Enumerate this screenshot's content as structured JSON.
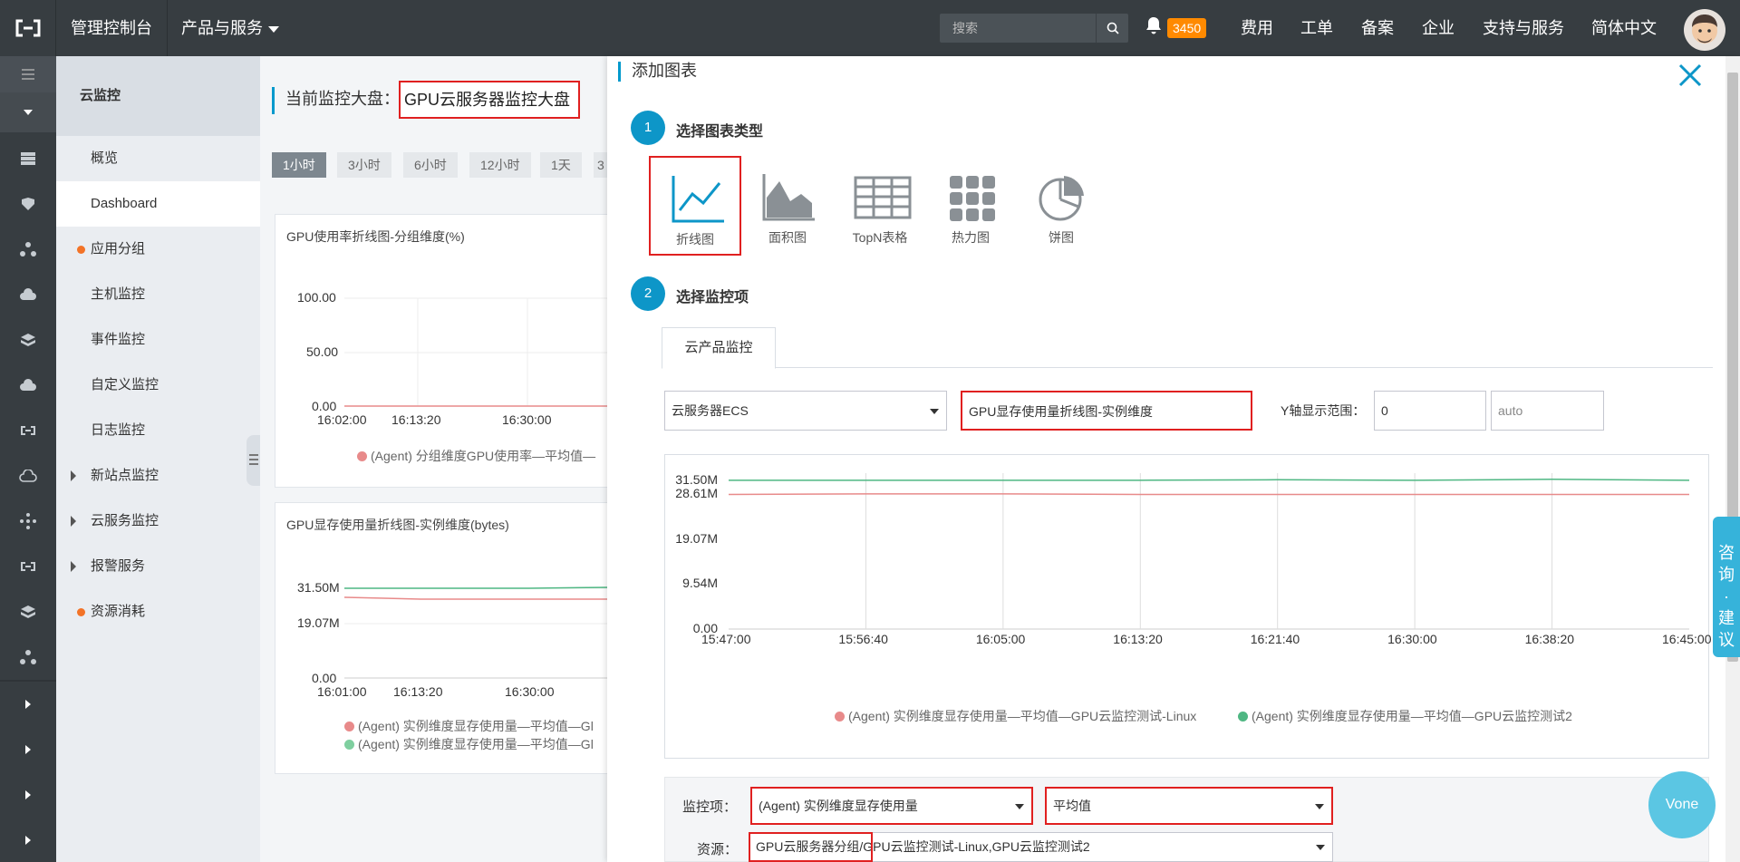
{
  "topbar": {
    "brand": "管理控制台",
    "products": "产品与服务",
    "search_placeholder": "搜索",
    "notification_count": "3450",
    "nav": [
      "费用",
      "工单",
      "备案",
      "企业",
      "支持与服务",
      "简体中文"
    ]
  },
  "sidebar": {
    "title": "云监控",
    "items": [
      {
        "label": "概览"
      },
      {
        "label": "Dashboard"
      },
      {
        "label": "应用分组"
      },
      {
        "label": "主机监控"
      },
      {
        "label": "事件监控"
      },
      {
        "label": "自定义监控"
      },
      {
        "label": "日志监控"
      },
      {
        "label": "新站点监控"
      },
      {
        "label": "云服务监控"
      },
      {
        "label": "报警服务"
      },
      {
        "label": "资源消耗"
      }
    ]
  },
  "main": {
    "current_label": "当前监控大盘：",
    "dashboard_name": "GPU云服务器监控大盘",
    "time_buttons": [
      "1小时",
      "3小时",
      "6小时",
      "12小时",
      "1天",
      "3"
    ],
    "card1": {
      "title": "GPU使用率折线图-分组维度(%)",
      "y_ticks": [
        "100.00",
        "50.00",
        "0.00"
      ],
      "x_ticks": [
        "16:02:00",
        "16:13:20",
        "16:30:00"
      ],
      "legend": "(Agent) 分组维度GPU使用率—平均值—"
    },
    "card2": {
      "title": "GPU显存使用量折线图-实例维度(bytes)",
      "y_ticks": [
        "31.50M",
        "19.07M",
        "0.00"
      ],
      "x_ticks": [
        "16:01:00",
        "16:13:20",
        "16:30:00"
      ],
      "legend": [
        "(Agent) 实例维度显存使用量—平均值—Gl",
        "(Agent) 实例维度显存使用量—平均值—Gl"
      ]
    }
  },
  "panel": {
    "title": "添加图表",
    "step1": {
      "num": "1",
      "label": "选择图表类型"
    },
    "chart_types": [
      {
        "label": "折线图",
        "icon": "line-chart-icon",
        "selected": true
      },
      {
        "label": "面积图",
        "icon": "area-chart-icon"
      },
      {
        "label": "TopN表格",
        "icon": "table-icon"
      },
      {
        "label": "热力图",
        "icon": "heatmap-icon"
      },
      {
        "label": "饼图",
        "icon": "pie-chart-icon"
      }
    ],
    "step2": {
      "num": "2",
      "label": "选择监控项"
    },
    "tab": "云产品监控",
    "product_select": "云服务器ECS",
    "chart_name": "GPU显存使用量折线图-实例维度",
    "y_range_label": "Y轴显示范围：",
    "y_min": "0",
    "y_max_placeholder": "auto",
    "metric_label": "监控项：",
    "metric_value": "(Agent) 实例维度显存使用量",
    "stat_value": "平均值",
    "resource_label": "资源：",
    "resource_value": "GPU云服务器分组/GPU云监控测试-Linux,GPU云监控测试2"
  },
  "chart_data": {
    "type": "line",
    "x": [
      "15:47:00",
      "15:56:40",
      "16:05:00",
      "16:13:20",
      "16:21:40",
      "16:30:00",
      "16:38:20",
      "16:45:00"
    ],
    "y_ticks": [
      "31.50M",
      "28.61M",
      "19.07M",
      "9.54M",
      "0.00"
    ],
    "ylim": [
      0,
      33
    ],
    "series": [
      {
        "name": "(Agent) 实例维度显存使用量—平均值—GPU云监控测试-Linux",
        "color": "#e88a8a",
        "values": [
          28.5,
          28.6,
          28.6,
          28.5,
          28.5,
          28.5,
          28.5,
          28.5
        ]
      },
      {
        "name": "(Agent) 实例维度显存使用量—平均值—GPU云监控测试2",
        "color": "#4fb783",
        "values": [
          31.5,
          31.5,
          31.5,
          31.5,
          31.6,
          31.5,
          31.7,
          31.5
        ]
      }
    ]
  },
  "feedback": "咨询·建议",
  "vone": "Vone",
  "colors": {
    "accent": "#0d96c8",
    "highlight": "#e02020",
    "dark": "#373d41"
  }
}
